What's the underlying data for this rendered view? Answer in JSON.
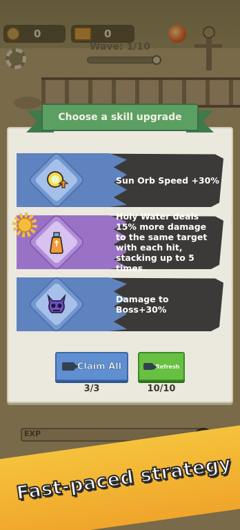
{
  "hud": {
    "coins": "0",
    "gems": "0",
    "wave": "Wave: 1/10",
    "exp_label": "EXP"
  },
  "modal": {
    "title": "Choose a skill upgrade",
    "skills": [
      {
        "label": "Sun Orb Speed +30%",
        "icon": "sun-orb-icon",
        "theme": "blue"
      },
      {
        "label": "Holy Water deals 15% more damage to the same target with each hit,  stacking up to 5 times.",
        "icon": "holy-water-icon",
        "theme": "purple"
      },
      {
        "label": "Damage to Boss+30%",
        "icon": "demon-skull-icon",
        "theme": "blue"
      }
    ],
    "claim_all": {
      "label": "Claim All",
      "count": "3/3"
    },
    "refresh": {
      "label": "Refresh",
      "count": "10/10"
    }
  },
  "promo": {
    "tagline": "Fast-paced strategy"
  },
  "colors": {
    "blue_card": "#5f83bf",
    "purple_card": "#9a72c5",
    "claim_button": "#5f8fd0",
    "refresh_button": "#67c041",
    "title_ribbon": "#5c9f63",
    "banner": "#f5c23b"
  }
}
